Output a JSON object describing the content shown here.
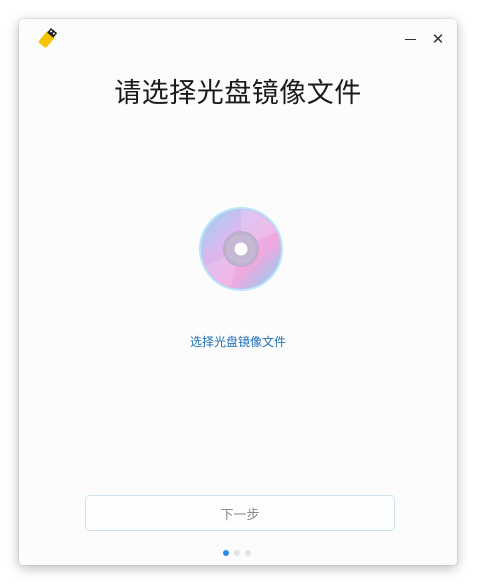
{
  "window": {
    "title": "请选择光盘镜像文件",
    "minimize_glyph": "—",
    "close_glyph": "✕",
    "app_icon": "usb-drive-icon"
  },
  "main": {
    "disc_icon": "optical-disc-icon",
    "select_link": "选择光盘镜像文件"
  },
  "footer": {
    "next_button": "下一步",
    "page_indicator": {
      "total": 3,
      "current": 1
    }
  },
  "colors": {
    "link": "#1f6fb7",
    "dot_active": "#2b8ce6",
    "dot_inactive": "#e3e3e6",
    "button_border": "#cfe3ef"
  }
}
